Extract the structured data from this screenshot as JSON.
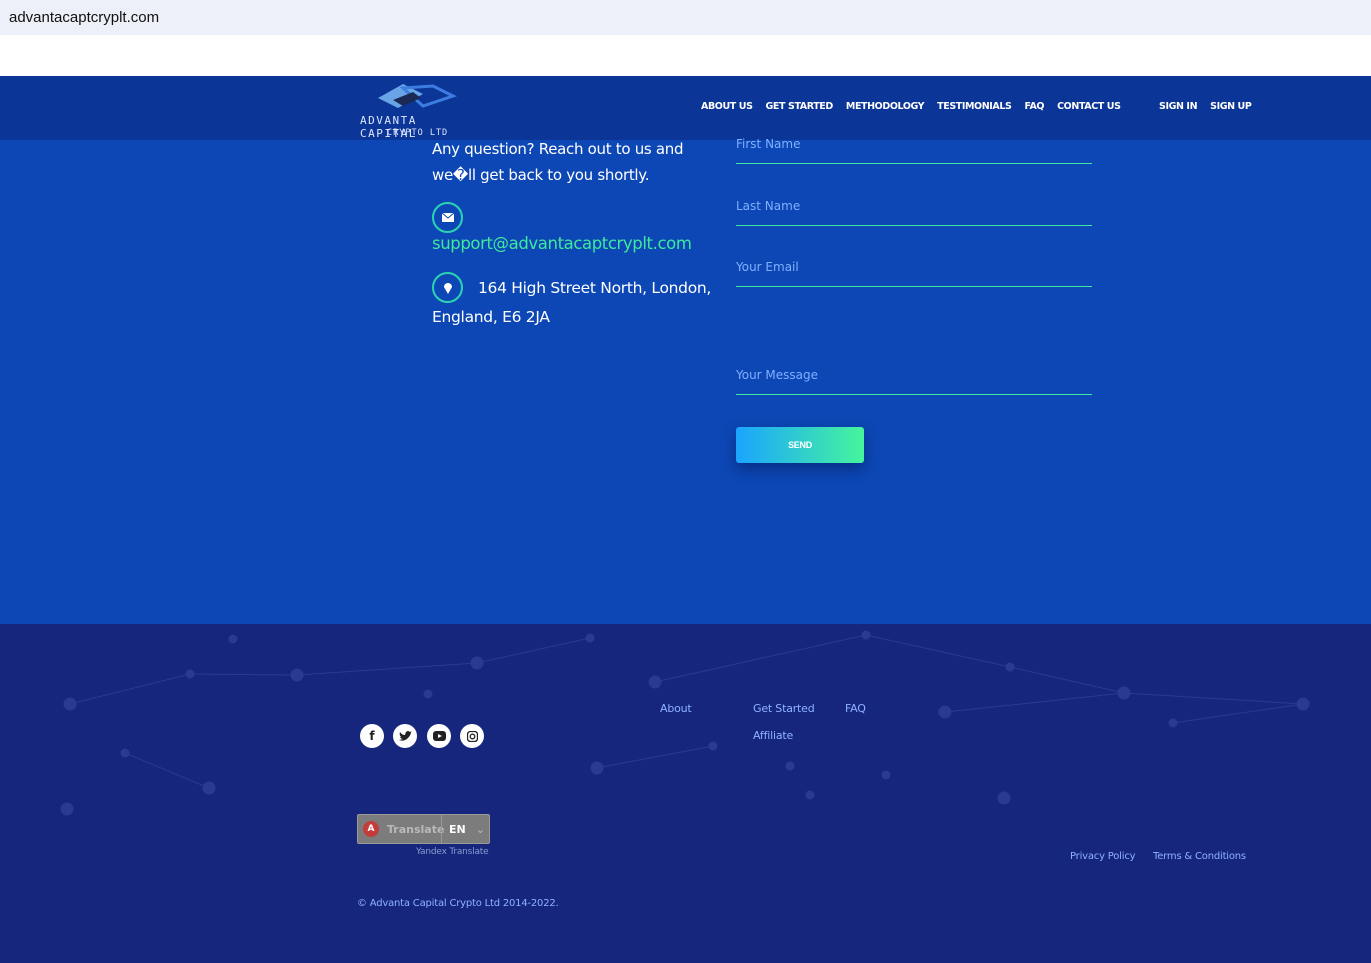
{
  "browser": {
    "url": "advantacaptcryplt.com"
  },
  "header": {
    "logo_line1": "ADVANTA CAPITAL",
    "logo_line2": "CRYPTO LTD",
    "nav": [
      "ABOUT US",
      "GET STARTED",
      "METHODOLOGY",
      "TESTIMONIALS",
      "FAQ",
      "CONTACT US"
    ],
    "auth": [
      "SIGN IN",
      "SIGN UP"
    ]
  },
  "contact": {
    "intro": "Any question? Reach out to us and we�ll get back to you shortly.",
    "email": "support@advantacaptcryplt.com",
    "address": "164 High Street North, London, England, E6 2JA"
  },
  "form": {
    "first_name": "First Name",
    "last_name": "Last Name",
    "email": "Your Email",
    "message": "Your Message",
    "send": "SEND"
  },
  "footer": {
    "links": [
      "About",
      "Get Started",
      "FAQ",
      "Affiliate"
    ],
    "social": [
      "facebook",
      "twitter",
      "youtube",
      "instagram"
    ],
    "translate": {
      "label": "Translate",
      "lang": "EN",
      "credit": "Yandex Translate"
    },
    "legal": [
      "Privacy Policy",
      "Terms & Conditions"
    ],
    "copyright": "© Advanta Capital Crypto Ltd 2014-2022."
  },
  "colors": {
    "header": "#0b3596",
    "main": "#0c47b5",
    "footer": "#15267c",
    "accent": "#3ee99e"
  }
}
